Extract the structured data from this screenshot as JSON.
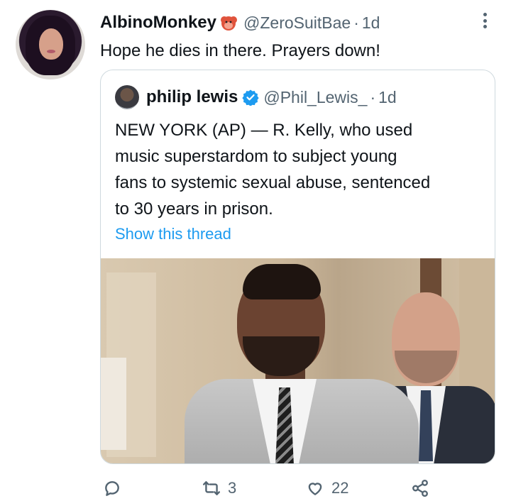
{
  "tweet": {
    "author_name": "AlbinoMonkey",
    "author_emoji": "monkey-emoji-icon",
    "handle": "@ZeroSuitBae",
    "separator": "·",
    "time": "1d",
    "text": "Hope he dies in there. Prayers down!"
  },
  "quoted": {
    "author_name": "philip lewis",
    "verified_icon": "verified-badge-icon",
    "handle": "@Phil_Lewis_",
    "separator": "·",
    "time": "1d",
    "text_lines": [
      "NEW YORK (AP) — R. Kelly, who used",
      "music superstardom to subject young",
      "fans to systemic sexual abuse, sentenced",
      "to 30 years in prison."
    ],
    "show_thread": "Show this thread"
  },
  "actions": {
    "reply_count": "",
    "retweet_count": "3",
    "like_count": "22"
  },
  "colors": {
    "link": "#1d9bf0",
    "secondary": "#536471",
    "border": "#cfd9de"
  }
}
